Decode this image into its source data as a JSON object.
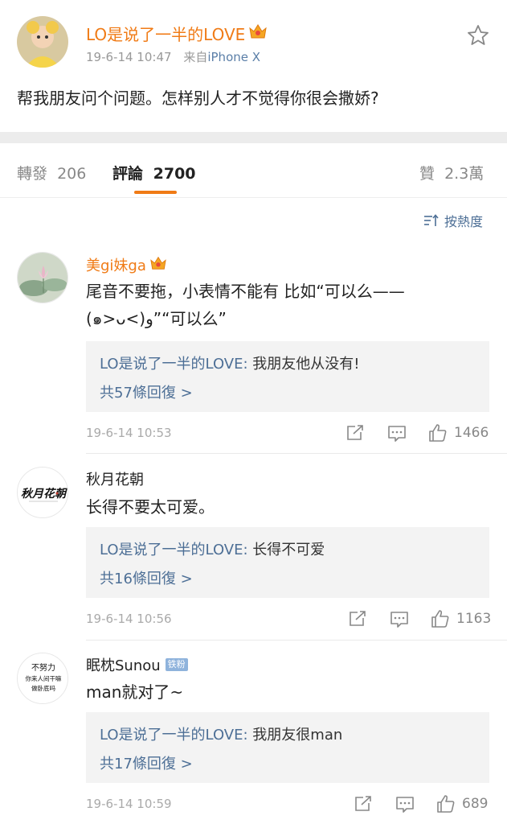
{
  "post": {
    "author": "LO是说了一半的LOVE",
    "time": "19-6-14 10:47",
    "source_prefix": "来自",
    "source": "iPhone X",
    "text": "帮我朋友问个问题。怎样别人才不觉得你很会撒娇?"
  },
  "tabs": {
    "reposts_label": "轉發",
    "reposts_count": "206",
    "comments_label": "評論",
    "comments_count": "2700",
    "likes_label": "贊",
    "likes_count": "2.3萬"
  },
  "sort_label": "按熱度",
  "comments": [
    {
      "name": "美gi妹ga",
      "text_line1": "尾音不要拖，小表情不能有  比如“可以么——",
      "text_line2": "(๑>ᴗ<)و”“可以么”",
      "reply_user": "LO是说了一半的LOVE:",
      "reply_text": "我朋友他从没有!",
      "reply_more": "共57條回復 >",
      "time": "19-6-14 10:53",
      "likes": "1466"
    },
    {
      "name": "秋月花朝",
      "avatar_text": "秋月花朝",
      "text_line1": "长得不要太可爱。",
      "reply_user": "LO是说了一半的LOVE:",
      "reply_text": "长得不可爱",
      "reply_more": "共16條回復 >",
      "time": "19-6-14 10:56",
      "likes": "1163"
    },
    {
      "name": "眠枕Sunou",
      "badge": "铁粉",
      "avatar_line1": "不努力",
      "avatar_line2": "你来人间干嘛",
      "avatar_line3": "做卧底吗",
      "text_line1": "man就对了~",
      "reply_user": "LO是说了一半的LOVE:",
      "reply_text": "我朋友很man",
      "reply_more": "共17條回復 >",
      "time": "19-6-14 10:59",
      "likes": "689"
    }
  ],
  "colors": {
    "accent": "#f07b16",
    "link": "#4d6f96",
    "muted": "#999999",
    "reply_bg": "#f3f3f3"
  }
}
